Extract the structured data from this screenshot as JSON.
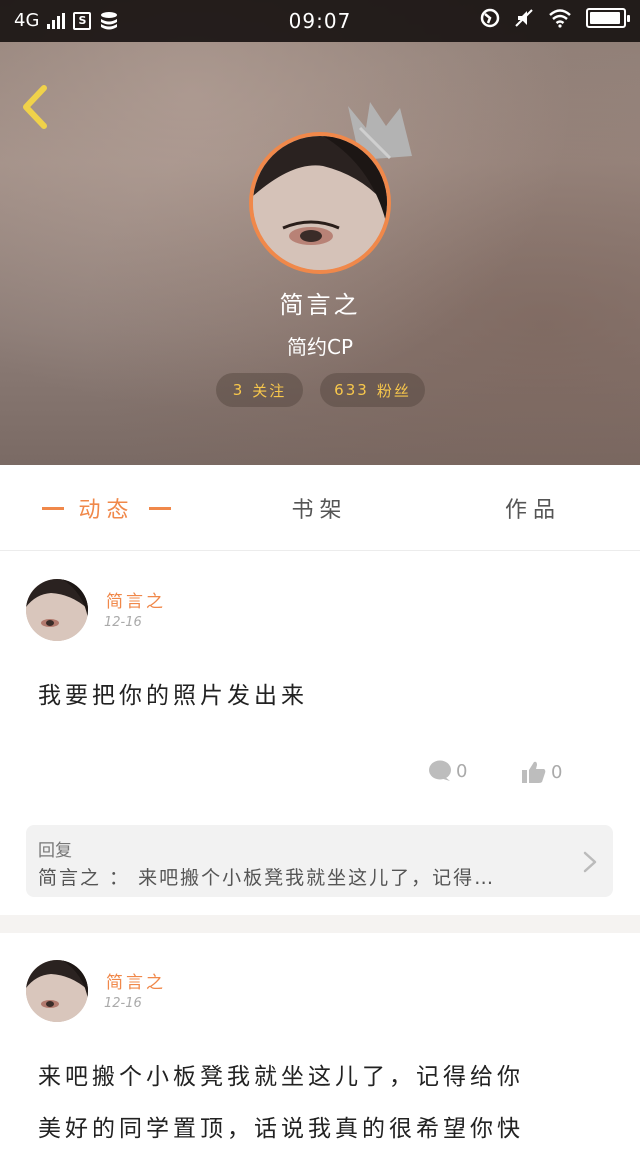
{
  "status_bar": {
    "network": "4G",
    "sim_icon": "S",
    "time": "09:07",
    "battery_level": 0.95,
    "icons": [
      "signal-bars-icon",
      "sim-icon",
      "database-icon",
      "data-saver-icon",
      "mute-icon",
      "wifi-icon",
      "battery-icon"
    ]
  },
  "profile": {
    "back_icon": "chevron-left-icon",
    "name": "简言之",
    "subtitle": "简约CP",
    "following_count": "3",
    "following_label": "关注",
    "fans_count": "633",
    "fans_label": "粉丝",
    "accent_color": "#f0884a",
    "stat_color": "#f7c74c"
  },
  "tabs": [
    {
      "label": "动态",
      "active": true
    },
    {
      "label": "书架",
      "active": false
    },
    {
      "label": "作品",
      "active": false
    }
  ],
  "posts": [
    {
      "author": "简言之",
      "date": "12-16",
      "text": "我要把你的照片发出来",
      "comments": "0",
      "likes": "0",
      "reply": {
        "label": "回复",
        "text": "简言之 ： 来吧搬个小板凳我就坐这儿了，记得…"
      }
    },
    {
      "author": "简言之",
      "date": "12-16",
      "text_line1": "来吧搬个小板凳我就坐这儿了，记得给你",
      "text_line2": "美好的同学置顶，话说我真的很希望你快"
    }
  ]
}
